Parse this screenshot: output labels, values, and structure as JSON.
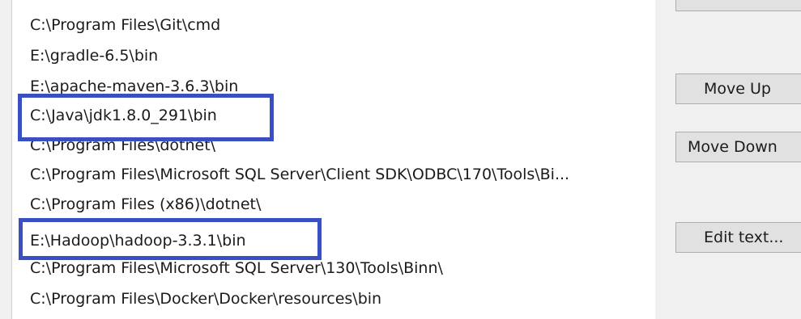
{
  "path_list": {
    "items": [
      "C:\\Program Files\\Git\\cmd",
      "E:\\gradle-6.5\\bin",
      "E:\\apache-maven-3.6.3\\bin",
      "C:\\Java\\jdk1.8.0_291\\bin",
      "C:\\Program Files\\dotnet\\",
      "C:\\Program Files\\Microsoft SQL Server\\Client SDK\\ODBC\\170\\Tools\\Bi...",
      "C:\\Program Files (x86)\\dotnet\\",
      "E:\\Hadoop\\hadoop-3.3.1\\bin",
      "C:\\Program Files\\Microsoft SQL Server\\130\\Tools\\Binn\\",
      "C:\\Program Files\\Docker\\Docker\\resources\\bin"
    ],
    "highlighted_indices": [
      3,
      7
    ],
    "highlight_color": "#3a4fc2"
  },
  "buttons": {
    "move_up": "Move Up",
    "move_down": "Move Down",
    "edit_text": "Edit text..."
  }
}
